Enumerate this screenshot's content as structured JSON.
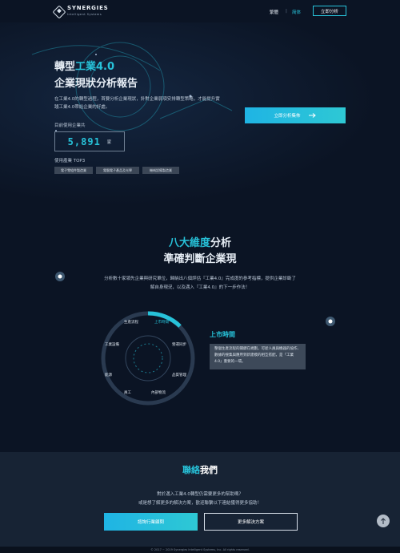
{
  "header": {
    "logo_name": "SYNERGIES",
    "logo_sub": "Intelligent Systems",
    "lang_tc": "繁體",
    "lang_sc": "简体",
    "lang_sep": "|",
    "cta": "立即分析"
  },
  "hero": {
    "title_prefix": "轉型",
    "title_accent": "工業4.0",
    "title_line2": "企業現狀分析報告",
    "desc": "在工業4.0的轉型過程，首要分析企業現狀，針對企業弱項安排轉型策略，才能提升實踐工業4.0帶給企業的好處。",
    "stat_label": "目前使用企業共",
    "stat_value": "5,891",
    "stat_unit": "家",
    "top3_label": "使用產業 TOP3",
    "tags": [
      "電子零組件製造業",
      "電腦電子產品及光學",
      "機械設備製造業"
    ],
    "cta": "立即分析集佈"
  },
  "dimensions": {
    "title_accent": "八大維度",
    "title_rest": "分析",
    "title_line2": "準確判斷企業現",
    "desc": "分析數十家領先企業與研究單位，歸納出八個評估『工業4.0』完成度的參考指標，提供企業診斷了解自身現況，以及邁入『工業4.0』的下一步作法！",
    "wheel_labels": [
      "上市時間",
      "營運同步",
      "品質管理",
      "內部物流",
      "員工",
      "能源",
      "工業設備",
      "生產流程"
    ],
    "active_title": "上市時間",
    "active_desc": "整個生產流程的關鍵在規劃，可從人員與機器的協作、數據的搜集與應用到新建模的相互搭配，是『工業4.0』重要的一環。"
  },
  "contact": {
    "title_accent": "聯絡",
    "title_rest": "我們",
    "desc_line1": "對於邁入工業4.0轉型仍需要更多的幫助嗎？",
    "desc_line2": "或是想了解更多的解決方案，歡迎聯繫以下連結獲得更多協助！",
    "btn_primary": "諮詢行業顧問",
    "btn_secondary": "更多解決方案"
  },
  "footer": {
    "copyright": "© 2017 ~ 2019 Synergies Intelligent Systems, Inc. All rights reserved."
  },
  "colors": {
    "accent": "#27c2d9",
    "background": "#0b1424",
    "contact_bg": "#172334"
  },
  "icons": {
    "arrow": "arrow-right-icon",
    "to_top": "arrow-up-icon"
  }
}
